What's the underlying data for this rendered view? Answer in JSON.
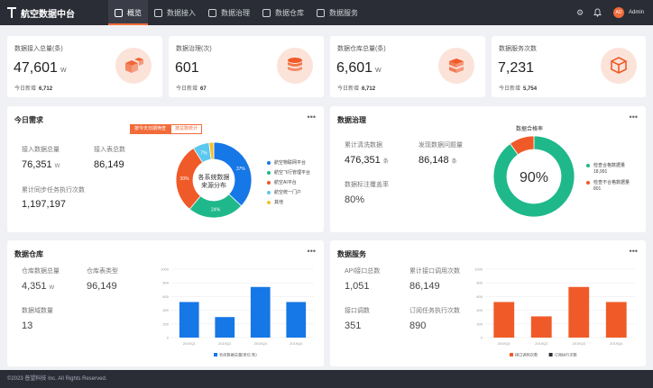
{
  "app": {
    "title": "航空数据中台",
    "user": "Admin",
    "avatar_text": "AD"
  },
  "nav": [
    {
      "label": "概览",
      "icon": "home-icon"
    },
    {
      "label": "数据接入",
      "icon": "database-icon"
    },
    {
      "label": "数据治理",
      "icon": "database-icon"
    },
    {
      "label": "数据仓库",
      "icon": "warehouse-icon"
    },
    {
      "label": "数据服务",
      "icon": "server-icon"
    }
  ],
  "stats": [
    {
      "label": "数据接入总量(条)",
      "value": "47,601",
      "unit": "W",
      "sub_label": "今日新增",
      "sub_value": "6,712",
      "icon": "boxes-icon"
    },
    {
      "label": "数据治理(次)",
      "value": "601",
      "unit": "",
      "sub_label": "今日新增",
      "sub_value": "67",
      "icon": "database-stack-icon"
    },
    {
      "label": "数据仓库总量(条)",
      "value": "6,601",
      "unit": "W",
      "sub_label": "今日新增",
      "sub_value": "6,712",
      "icon": "stacked-boxes-icon"
    },
    {
      "label": "数据服务次数",
      "value": "7,231",
      "unit": "",
      "sub_label": "今日新增",
      "sub_value": "5,754",
      "icon": "cube-network-icon"
    }
  ],
  "today": {
    "title": "今日需求",
    "tabs": [
      "按今天日期筛查",
      "按总数统计"
    ],
    "metrics": [
      {
        "label": "接入数据总量",
        "value": "76,351",
        "unit": "W"
      },
      {
        "label": "接入表总数",
        "value": "86,149",
        "unit": ""
      },
      {
        "label": "累计同步任务执行次数",
        "value": "1,197,197",
        "unit": ""
      }
    ],
    "donut_center": [
      "各系统数据",
      "来源分布"
    ],
    "legend": [
      "航空物联网平台",
      "航空飞行管理平台",
      "航空AI平台",
      "航空统一门户",
      "其他"
    ]
  },
  "governance": {
    "title": "数据治理",
    "metrics": [
      {
        "label": "累计清洗数据",
        "value": "476,351",
        "unit": "条"
      },
      {
        "label": "发现数据问题量",
        "value": "86,148",
        "unit": "条"
      },
      {
        "label": "数据标注覆盖率",
        "value": "80%",
        "unit": ""
      }
    ],
    "chart_title": "数据合格率",
    "center": "90%",
    "legend": [
      {
        "label": "检查合格数据量",
        "value": "18,991"
      },
      {
        "label": "检查不合格数据量",
        "value": "801"
      }
    ]
  },
  "warehouse": {
    "title": "数据仓库",
    "metrics": [
      {
        "label": "仓库数据总量",
        "value": "4,351",
        "unit": "W"
      },
      {
        "label": "仓库表类型",
        "value": "96,149",
        "unit": ""
      },
      {
        "label": "数据域数量",
        "value": "13",
        "unit": ""
      }
    ],
    "legend": "仓库数据总量(单位:条)"
  },
  "service": {
    "title": "数据服务",
    "metrics": [
      {
        "label": "API接口总数",
        "value": "1,051",
        "unit": ""
      },
      {
        "label": "累计接口调用次数",
        "value": "86,149",
        "unit": ""
      },
      {
        "label": "接口调数",
        "value": "351",
        "unit": ""
      },
      {
        "label": "订阅任务执行次数",
        "value": "890",
        "unit": ""
      }
    ],
    "legend": [
      "接口调用次数",
      "订阅执行次数"
    ]
  },
  "footer": "©2023 普望科技 Inc. All Rights Reserved.",
  "colors": {
    "accent": "#f26b3a",
    "blue": "#1677e6",
    "green": "#1fb88a",
    "dark": "#2a2d36"
  },
  "chart_data": [
    {
      "type": "pie",
      "title": "各系统数据来源分布",
      "categories": [
        "航空物联网平台",
        "航空飞行管理平台",
        "航空AI平台",
        "航空统一门户",
        "其他"
      ],
      "values": [
        37,
        24,
        30,
        7,
        2
      ],
      "value_labels": [
        "37%",
        "24%",
        "30%",
        "7%",
        ""
      ],
      "colors": [
        "#1677e6",
        "#1fb88a",
        "#f05a28",
        "#5bc8f0",
        "#f5c02a"
      ]
    },
    {
      "type": "pie",
      "title": "数据合格率",
      "categories": [
        "检查合格数据量",
        "检查不合格数据量"
      ],
      "values": [
        18991,
        801
      ],
      "display_ratio": [
        90,
        10
      ],
      "colors": [
        "#1fb88a",
        "#f05a28"
      ]
    },
    {
      "type": "bar",
      "title": "",
      "categories": [
        "2019Q1",
        "2019Q2",
        "2019Q3",
        "2019Q4"
      ],
      "y_ticks": [
        "0",
        "200",
        "400",
        "600",
        "800",
        "1000"
      ],
      "ylim": [
        0,
        1000
      ],
      "series": [
        {
          "name": "仓库数据总量(单位:条)",
          "values": [
            520,
            300,
            740,
            520
          ]
        }
      ],
      "colors": [
        "#1677e6"
      ]
    },
    {
      "type": "bar",
      "title": "",
      "categories": [
        "2019Q1",
        "2019Q2",
        "2019Q3",
        "2019Q4"
      ],
      "y_ticks": [
        "0",
        "200",
        "400",
        "600",
        "800",
        "1000"
      ],
      "ylim": [
        0,
        1000
      ],
      "series": [
        {
          "name": "接口调用次数",
          "values": [
            520,
            310,
            740,
            520
          ]
        }
      ],
      "colors": [
        "#f05a28"
      ]
    }
  ]
}
